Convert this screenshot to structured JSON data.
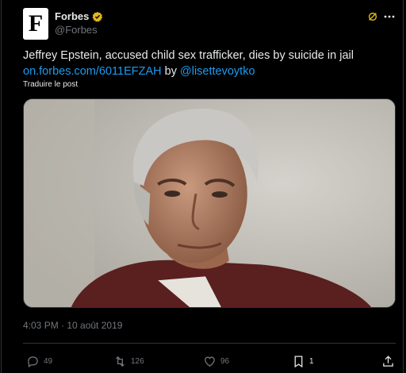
{
  "account": {
    "name": "Forbes",
    "handle": "@Forbes",
    "avatar_letter": "F"
  },
  "tweet": {
    "text": "Jeffrey Epstein, accused child sex trafficker, dies by suicide in jail",
    "link": "on.forbes.com/6011EFZAH",
    "by_label": "by",
    "mention": "@lisettevoytko",
    "translate_label": "Traduire le post",
    "timestamp": "4:03 PM · 10 août 2019"
  },
  "actions": {
    "replies": "49",
    "retweets": "126",
    "likes": "96",
    "bookmarks": "1"
  },
  "icons": [
    "verified-badge-icon",
    "grok-icon",
    "more-icon",
    "reply-icon",
    "retweet-icon",
    "like-icon",
    "bookmark-icon",
    "share-icon"
  ],
  "colors": {
    "background": "#000000",
    "text": "#e7e9ea",
    "secondary": "#71767b",
    "link": "#1d9bf0",
    "verified": "#e2b719"
  }
}
